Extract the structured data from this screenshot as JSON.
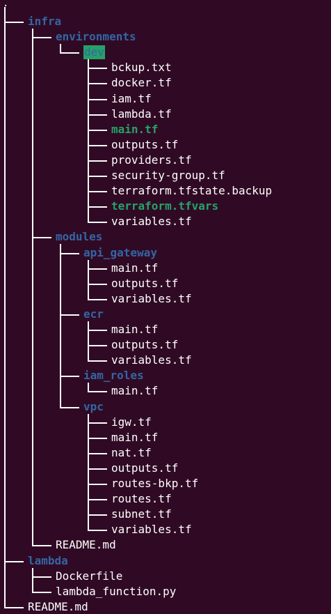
{
  "terminal": {
    "background": "#300a24",
    "dir_color": "#3465a4",
    "exec_color": "#26a269",
    "file_color": "#ffffff",
    "root": ".",
    "tree": [
      {
        "label": "infra",
        "kind": "dir",
        "depth": 1
      },
      {
        "label": "environments",
        "kind": "dir",
        "depth": 2
      },
      {
        "label": "dev",
        "kind": "highlight",
        "depth": 3
      },
      {
        "label": "bckup.txt",
        "kind": "file",
        "depth": 4
      },
      {
        "label": "docker.tf",
        "kind": "file",
        "depth": 4
      },
      {
        "label": "iam.tf",
        "kind": "file",
        "depth": 4
      },
      {
        "label": "lambda.tf",
        "kind": "file",
        "depth": 4
      },
      {
        "label": "main.tf",
        "kind": "exec",
        "depth": 4
      },
      {
        "label": "outputs.tf",
        "kind": "file",
        "depth": 4
      },
      {
        "label": "providers.tf",
        "kind": "file",
        "depth": 4
      },
      {
        "label": "security-group.tf",
        "kind": "file",
        "depth": 4
      },
      {
        "label": "terraform.tfstate.backup",
        "kind": "file",
        "depth": 4
      },
      {
        "label": "terraform.tfvars",
        "kind": "exec",
        "depth": 4
      },
      {
        "label": "variables.tf",
        "kind": "file",
        "depth": 4
      },
      {
        "label": "modules",
        "kind": "dir",
        "depth": 2
      },
      {
        "label": "api_gateway",
        "kind": "dir",
        "depth": 3
      },
      {
        "label": "main.tf",
        "kind": "file",
        "depth": 4
      },
      {
        "label": "outputs.tf",
        "kind": "file",
        "depth": 4
      },
      {
        "label": "variables.tf",
        "kind": "file",
        "depth": 4
      },
      {
        "label": "ecr",
        "kind": "dir",
        "depth": 3
      },
      {
        "label": "main.tf",
        "kind": "file",
        "depth": 4
      },
      {
        "label": "outputs.tf",
        "kind": "file",
        "depth": 4
      },
      {
        "label": "variables.tf",
        "kind": "file",
        "depth": 4
      },
      {
        "label": "iam_roles",
        "kind": "dir",
        "depth": 3
      },
      {
        "label": "main.tf",
        "kind": "file",
        "depth": 4
      },
      {
        "label": "vpc",
        "kind": "dir",
        "depth": 3
      },
      {
        "label": "igw.tf",
        "kind": "file",
        "depth": 4
      },
      {
        "label": "main.tf",
        "kind": "file",
        "depth": 4
      },
      {
        "label": "nat.tf",
        "kind": "file",
        "depth": 4
      },
      {
        "label": "outputs.tf",
        "kind": "file",
        "depth": 4
      },
      {
        "label": "routes-bkp.tf",
        "kind": "file",
        "depth": 4
      },
      {
        "label": "routes.tf",
        "kind": "file",
        "depth": 4
      },
      {
        "label": "subnet.tf",
        "kind": "file",
        "depth": 4
      },
      {
        "label": "variables.tf",
        "kind": "file",
        "depth": 4
      },
      {
        "label": "README.md",
        "kind": "file",
        "depth": 2
      },
      {
        "label": "lambda",
        "kind": "dir",
        "depth": 1
      },
      {
        "label": "Dockerfile",
        "kind": "file",
        "depth": 2
      },
      {
        "label": "lambda_function.py",
        "kind": "file",
        "depth": 2
      },
      {
        "label": "README.md",
        "kind": "file",
        "depth": 1
      }
    ]
  }
}
